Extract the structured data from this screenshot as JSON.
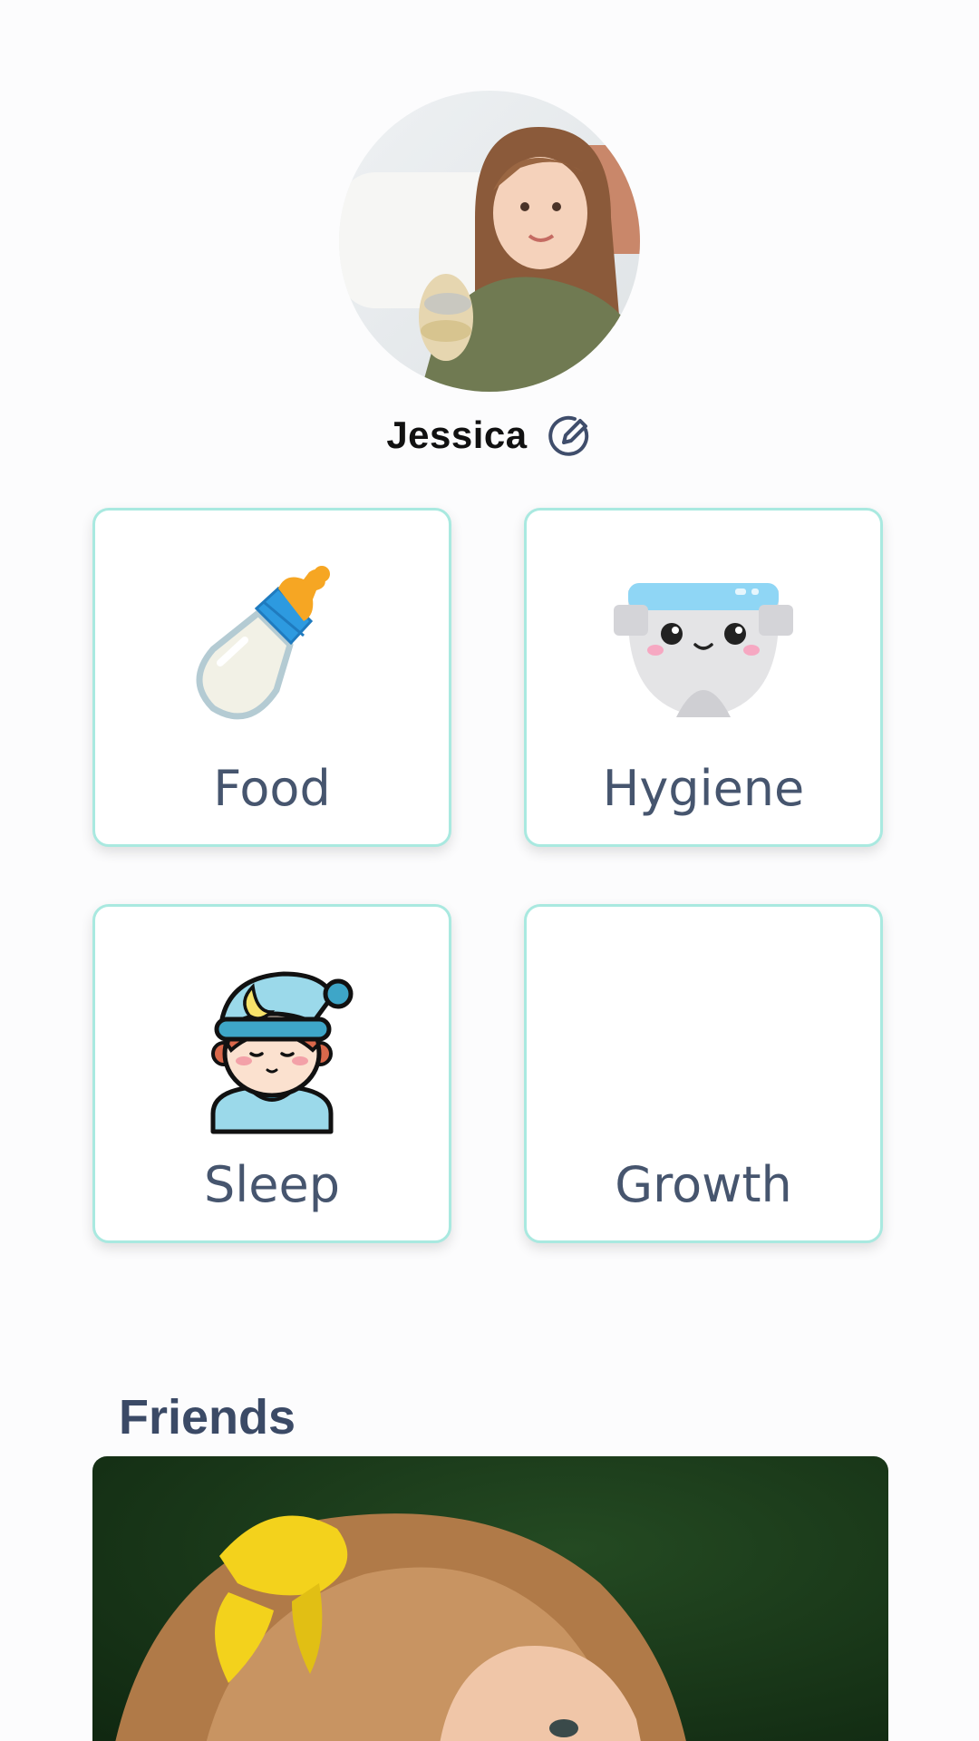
{
  "profile": {
    "name": "Jessica",
    "avatar_icon": "child-portrait-photo",
    "edit_icon": "edit-pencil-icon"
  },
  "categories": [
    {
      "label": "Food",
      "icon": "baby-bottle-icon"
    },
    {
      "label": "Hygiene",
      "icon": "diaper-icon"
    },
    {
      "label": "Sleep",
      "icon": "sleeping-baby-icon"
    },
    {
      "label": "Growth",
      "icon": ""
    }
  ],
  "friends": {
    "title": "Friends",
    "photo": "friend-photo"
  },
  "colors": {
    "card_border": "#a9e9e0",
    "label_text": "#46556e",
    "section_title": "#3b4a66",
    "accent_blue": "#3f4d6b"
  }
}
